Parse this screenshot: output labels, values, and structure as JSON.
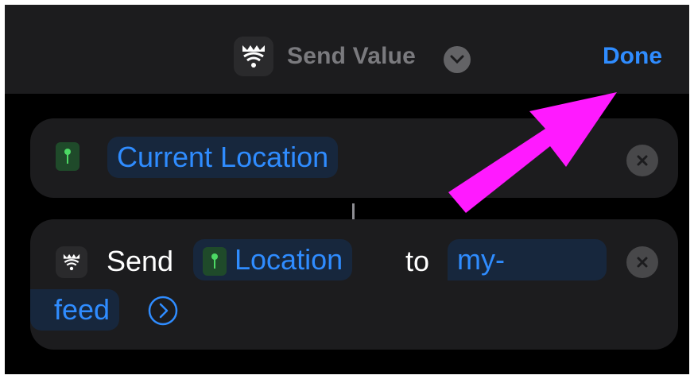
{
  "header": {
    "title": "Send Value",
    "done_label": "Done"
  },
  "action1": {
    "variable_label": "Current Location"
  },
  "action2": {
    "send_label": "Send",
    "location_label": "Location",
    "to_label": "to",
    "feed_part1": "my-",
    "feed_part2": "feed"
  },
  "colors": {
    "accent": "#2f8cff",
    "annotation_arrow": "#ff1aff",
    "background": "#000000",
    "card": "#1c1c1e"
  },
  "icons": {
    "app": "wifi-crown-icon",
    "location": "map-pin-icon",
    "dropdown": "chevron-down-icon",
    "remove": "close-icon",
    "more": "chevron-right-circle-icon"
  }
}
